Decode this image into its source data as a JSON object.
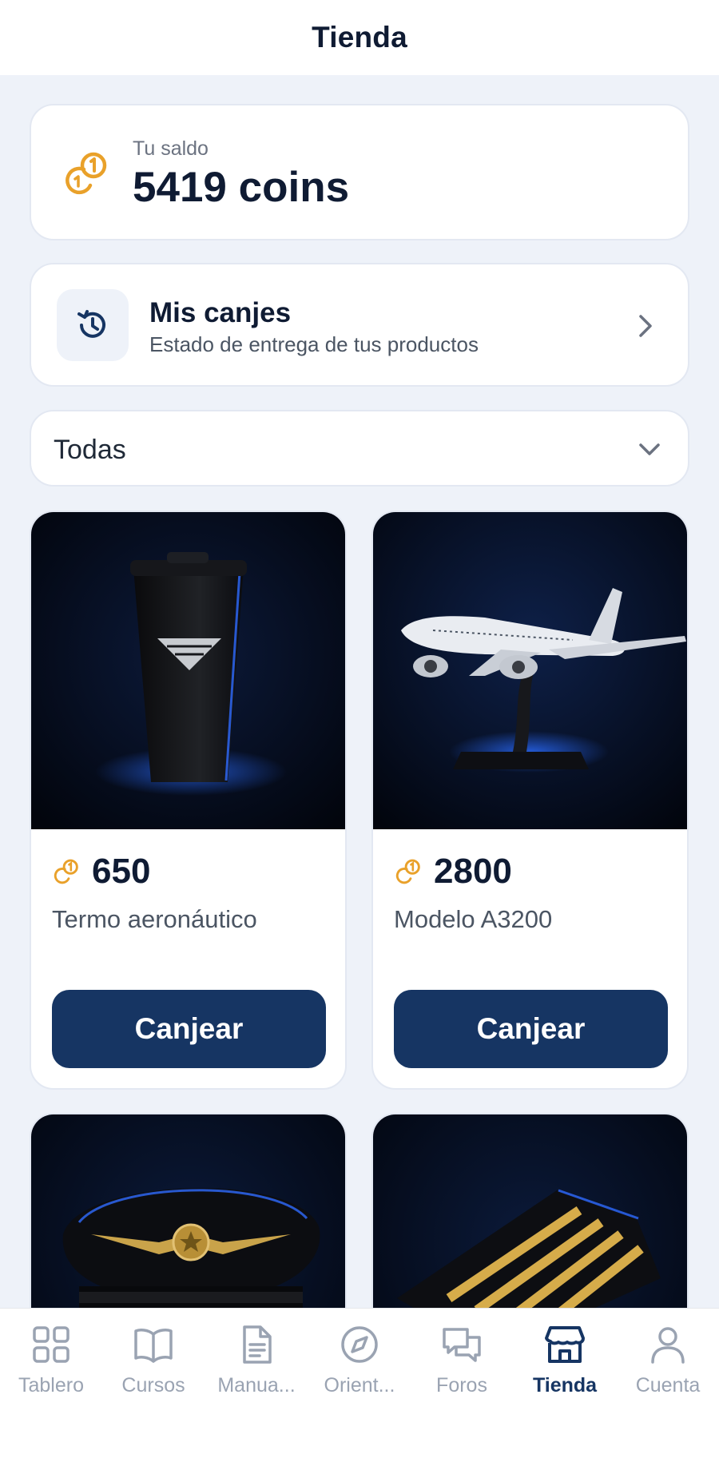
{
  "header": {
    "title": "Tienda"
  },
  "balance": {
    "label": "Tu saldo",
    "amount": "5419 coins",
    "icon": "coins-icon"
  },
  "redeems": {
    "title": "Mis canjes",
    "subtitle": "Estado de entrega de tus productos",
    "icon": "history-icon"
  },
  "filter": {
    "selected": "Todas"
  },
  "products": [
    {
      "price": "650",
      "name": "Termo aeronáutico",
      "button": "Canjear",
      "image": "black-tumbler-photo"
    },
    {
      "price": "2800",
      "name": "Modelo A3200",
      "button": "Canjear",
      "image": "airplane-model-photo"
    },
    {
      "image": "pilot-cap-photo"
    },
    {
      "image": "pilot-epaulettes-photo"
    }
  ],
  "tabs": [
    {
      "label": "Tablero",
      "icon": "dashboard-icon",
      "active": false
    },
    {
      "label": "Cursos",
      "icon": "book-icon",
      "active": false
    },
    {
      "label": "Manua...",
      "icon": "document-icon",
      "active": false
    },
    {
      "label": "Orient...",
      "icon": "compass-icon",
      "active": false
    },
    {
      "label": "Foros",
      "icon": "chat-icon",
      "active": false
    },
    {
      "label": "Tienda",
      "icon": "store-icon",
      "active": true
    },
    {
      "label": "Cuenta",
      "icon": "user-icon",
      "active": false
    }
  ],
  "colors": {
    "accent": "#163563",
    "coin": "#e9a12a",
    "background": "#eef2f9",
    "inactive_tab": "#9aa3b2"
  }
}
